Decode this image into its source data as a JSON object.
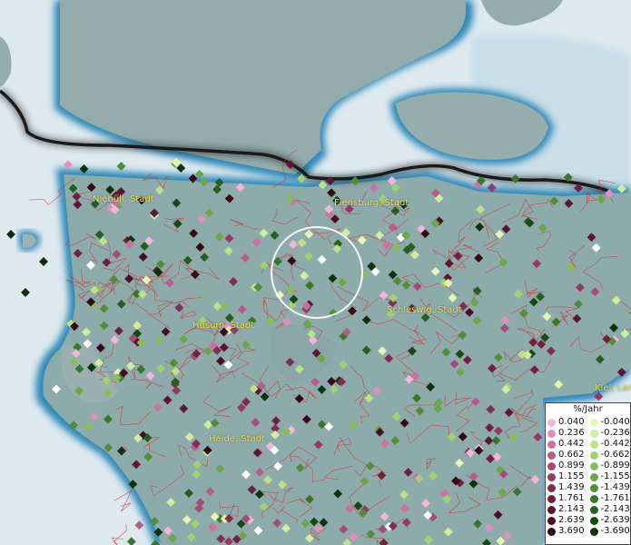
{
  "map": {
    "cities": [
      {
        "name": "Niebüll, Stadt"
      },
      {
        "name": "Flensburg, Stadt"
      },
      {
        "name": "Husum, Stadt"
      },
      {
        "name": "Schleswig, Stadt"
      },
      {
        "name": "Heide, Stadt"
      },
      {
        "name": "Kiel, Lan"
      }
    ]
  },
  "legend": {
    "title": "%/Jahr",
    "rows": [
      {
        "pos": "0.040",
        "neg": "-0.040",
        "pos_color": "#f2b6dc",
        "neg_color": "#e6f5b4"
      },
      {
        "pos": "0.236",
        "neg": "-0.236",
        "pos_color": "#e090c0",
        "neg_color": "#d2eca0"
      },
      {
        "pos": "0.442",
        "neg": "-0.442",
        "pos_color": "#cc70a2",
        "neg_color": "#bde08a"
      },
      {
        "pos": "0.662",
        "neg": "-0.662",
        "pos_color": "#b85c8c",
        "neg_color": "#a4d072"
      },
      {
        "pos": "0.899",
        "neg": "-0.899",
        "pos_color": "#a64a78",
        "neg_color": "#88bd5c"
      },
      {
        "pos": "1.155",
        "neg": "-1.155",
        "pos_color": "#943a64",
        "neg_color": "#6ca648"
      },
      {
        "pos": "1.439",
        "neg": "-1.439",
        "pos_color": "#822c52",
        "neg_color": "#528e38"
      },
      {
        "pos": "1.761",
        "neg": "-1.761",
        "pos_color": "#702040",
        "neg_color": "#3a762a"
      },
      {
        "pos": "2.143",
        "neg": "-2.143",
        "pos_color": "#5e1630",
        "neg_color": "#265e1e"
      },
      {
        "pos": "2.639",
        "neg": "-2.639",
        "pos_color": "#4a0e22",
        "neg_color": "#184814"
      },
      {
        "pos": "3.690",
        "neg": "-3.690",
        "pos_color": "#360816",
        "neg_color": "#0c320c"
      }
    ]
  }
}
